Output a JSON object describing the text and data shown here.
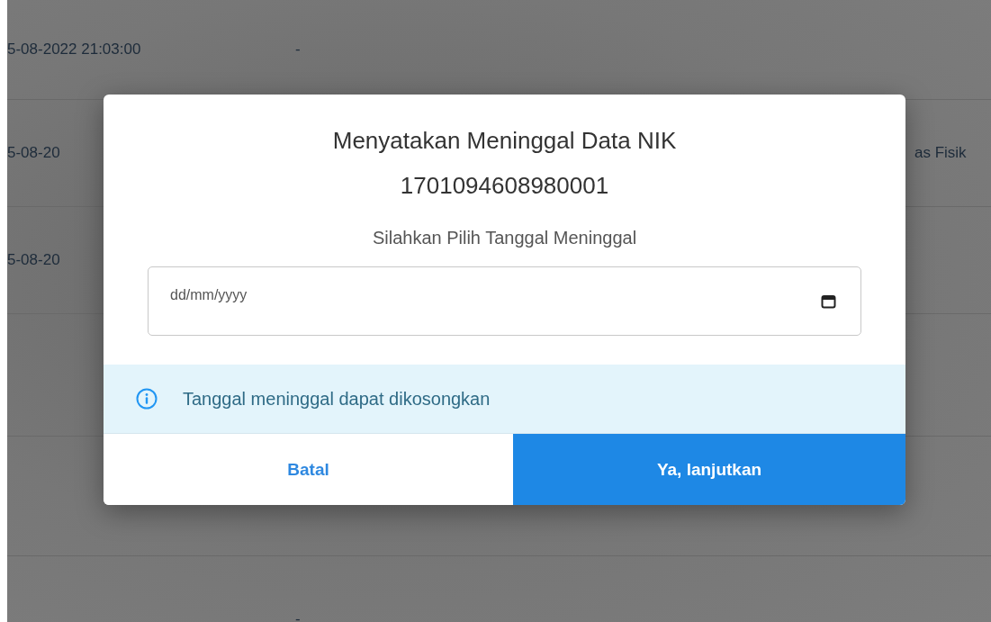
{
  "table": {
    "rows": [
      {
        "column_1": "5-08-2022 21:03:00",
        "column_2": "-",
        "column_3": ""
      },
      {
        "column_1": "5-08-20",
        "column_3": "as Fisik"
      },
      {
        "column_1": "5-08-20"
      },
      {},
      {},
      {
        "column_2": "-"
      }
    ]
  },
  "dialog": {
    "title": "Menyatakan Meninggal Data NIK 1701094608980001",
    "prompt": "Silahkan Pilih Tanggal Meninggal",
    "date_field": {
      "placeholder": "dd/mm/yyyy"
    },
    "info": "Tanggal meninggal dapat dikosongkan",
    "buttons": [
      {
        "label": "Batal",
        "kind": "secondary"
      },
      {
        "label": "Ya, lanjutkan",
        "kind": "primary"
      }
    ]
  }
}
